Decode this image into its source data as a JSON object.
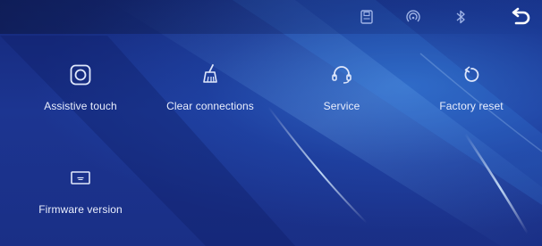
{
  "statusbar": {
    "icons": [
      "sd-card-icon",
      "signal-icon",
      "bluetooth-icon"
    ],
    "back_icon": "back-arrow-icon"
  },
  "menu": {
    "items": [
      {
        "label": "Assistive touch",
        "icon": "assistive-touch-icon"
      },
      {
        "label": "Clear connections",
        "icon": "broom-icon"
      },
      {
        "label": "Service",
        "icon": "headset-icon"
      },
      {
        "label": "Factory reset",
        "icon": "reset-icon"
      },
      {
        "label": "Firmware version",
        "icon": "firmware-icon"
      }
    ]
  },
  "colors": {
    "background": "#1c3591",
    "accent": "#3c8ceb",
    "text": "#e9eefc"
  }
}
